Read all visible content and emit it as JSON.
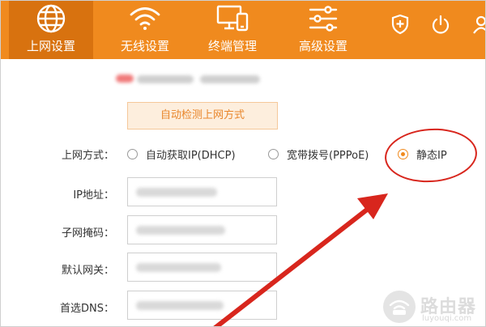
{
  "nav": {
    "tabs": [
      {
        "label": "上网设置",
        "icon": "globe-icon",
        "active": true
      },
      {
        "label": "无线设置",
        "icon": "wifi-icon",
        "active": false
      },
      {
        "label": "终端管理",
        "icon": "devices-icon",
        "active": false
      },
      {
        "label": "高级设置",
        "icon": "sliders-icon",
        "active": false
      }
    ],
    "utilities": [
      "shield-plus-icon",
      "power-icon",
      "user-icon"
    ]
  },
  "detect_button_label": "自动检测上网方式",
  "connection": {
    "label": "上网方式：",
    "options": [
      {
        "label": "自动获取IP(DHCP)",
        "checked": false
      },
      {
        "label": "宽带拨号(PPPoE)",
        "checked": false
      },
      {
        "label": "静态IP",
        "checked": true
      }
    ]
  },
  "fields": [
    {
      "label": "IP地址："
    },
    {
      "label": "子网掩码："
    },
    {
      "label": "默认网关："
    },
    {
      "label": "首选DNS："
    }
  ],
  "watermark": {
    "name": "路由器",
    "site": "luyouqi.com"
  },
  "colors": {
    "brand": "#f08a1e",
    "brand_dark": "#d8720f",
    "annotation": "#d8261d"
  }
}
